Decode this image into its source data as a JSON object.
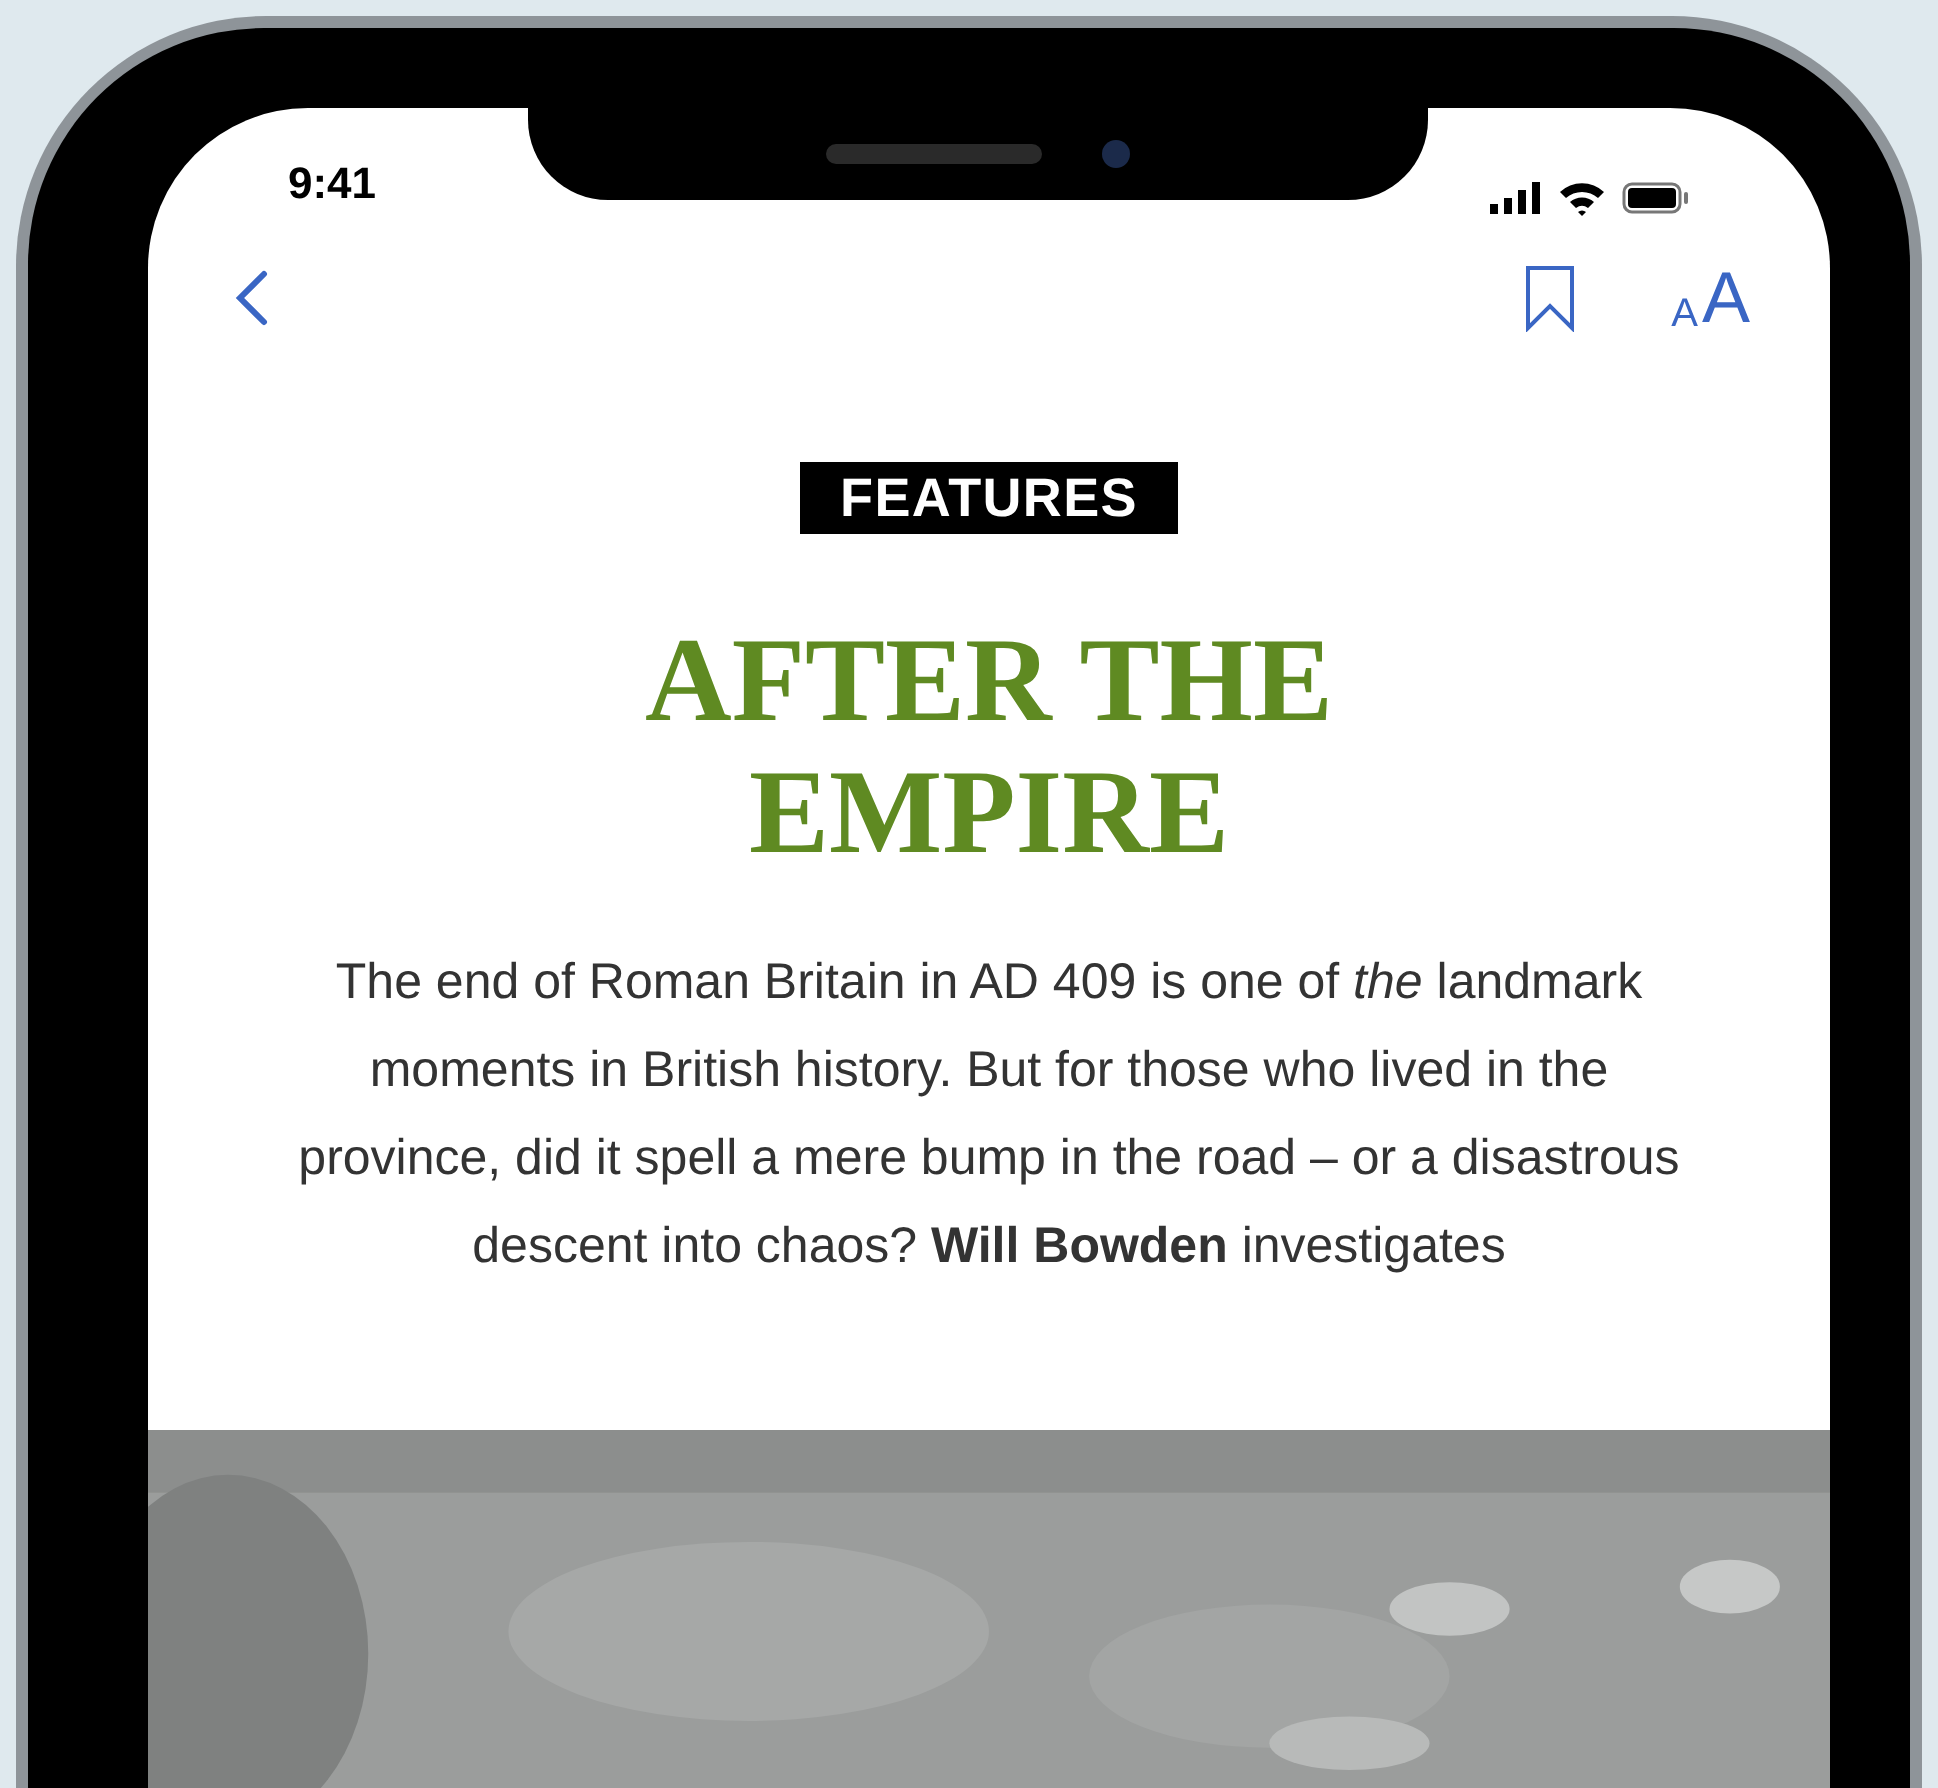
{
  "status_bar": {
    "time": "9:41"
  },
  "nav": {
    "text_size": [
      "A",
      "A"
    ]
  },
  "article": {
    "section": "FEATURES",
    "title": "AFTER THE EMPIRE",
    "standfirst": "The end of Roman Britain in AD 409 is one of *the* landmark moments in British history. But for those who lived in the province, did it spell a mere bump in the road – or a disastrous descent into chaos? **Will Bowden** investigates"
  }
}
